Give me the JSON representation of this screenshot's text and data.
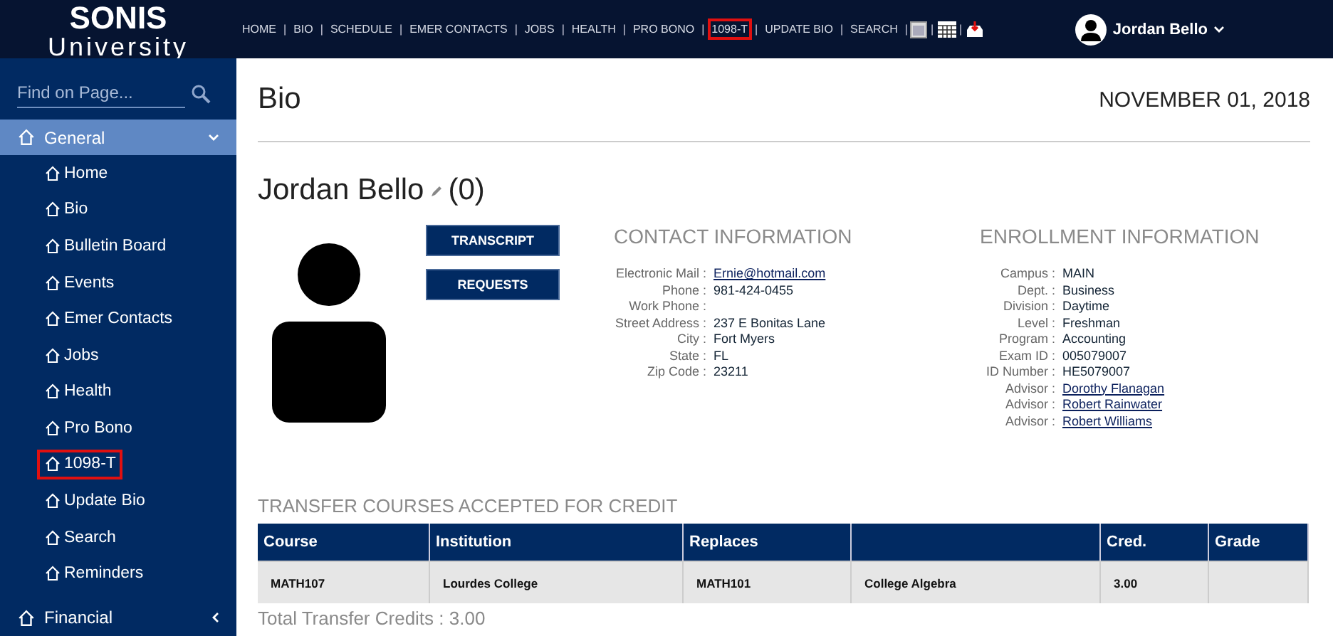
{
  "logo": {
    "line1": "SONIS",
    "line2": "University"
  },
  "top_nav": [
    {
      "label": "HOME",
      "highlighted": false
    },
    {
      "label": "BIO",
      "highlighted": false
    },
    {
      "label": "SCHEDULE",
      "highlighted": false
    },
    {
      "label": "EMER CONTACTS",
      "highlighted": false
    },
    {
      "label": "JOBS",
      "highlighted": false
    },
    {
      "label": "HEALTH",
      "highlighted": false
    },
    {
      "label": "PRO BONO",
      "highlighted": false
    },
    {
      "label": "1098-T",
      "highlighted": true
    },
    {
      "label": "UPDATE BIO",
      "highlighted": false
    },
    {
      "label": "SEARCH",
      "highlighted": false
    }
  ],
  "nav_separator": "|",
  "user": {
    "name": "Jordan Bello"
  },
  "sidebar": {
    "search": {
      "placeholder": "Find on Page..."
    },
    "groups": [
      {
        "label": "General",
        "expanded": true,
        "children": [
          {
            "label": "Home",
            "highlighted": false
          },
          {
            "label": "Bio",
            "highlighted": false
          },
          {
            "label": "Bulletin Board",
            "highlighted": false
          },
          {
            "label": "Events",
            "highlighted": false
          },
          {
            "label": "Emer Contacts",
            "highlighted": false
          },
          {
            "label": "Jobs",
            "highlighted": false
          },
          {
            "label": "Health",
            "highlighted": false
          },
          {
            "label": "Pro Bono",
            "highlighted": false
          },
          {
            "label": "1098-T",
            "highlighted": true
          },
          {
            "label": "Update Bio",
            "highlighted": false
          },
          {
            "label": "Search",
            "highlighted": false
          },
          {
            "label": "Reminders",
            "highlighted": false
          }
        ]
      },
      {
        "label": "Financial",
        "expanded": false
      }
    ]
  },
  "page": {
    "title": "Bio",
    "date": "NOVEMBER 01, 2018",
    "student_name": "Jordan Bello",
    "count": "(0)"
  },
  "buttons": [
    "TRANSCRIPT",
    "REQUESTS"
  ],
  "contact": {
    "title": "CONTACT INFORMATION",
    "fields": [
      {
        "label": "Electronic Mail :",
        "value": "Ernie@hotmail.com",
        "kind": "link"
      },
      {
        "label": "Phone :",
        "value": "981-424-0455",
        "kind": "text"
      },
      {
        "label": "Work Phone :"
      },
      {
        "label": "Street Address :",
        "value": "237 E Bonitas Lane",
        "kind": "text"
      },
      {
        "label": "City :",
        "value": "Fort Myers",
        "kind": "text"
      },
      {
        "label": "State :",
        "value": "FL",
        "kind": "text"
      },
      {
        "label": "Zip Code :",
        "value": "23211",
        "kind": "text"
      }
    ]
  },
  "enrollment": {
    "title": "ENROLLMENT INFORMATION",
    "fields": [
      {
        "label": "Campus :",
        "value": "MAIN",
        "kind": "text"
      },
      {
        "label": "Dept. :",
        "value": "Business",
        "kind": "text"
      },
      {
        "label": "Division :",
        "value": "Daytime",
        "kind": "text"
      },
      {
        "label": "Level :",
        "value": "Freshman",
        "kind": "text"
      },
      {
        "label": "Program :",
        "value": "Accounting",
        "kind": "text"
      },
      {
        "label": "Exam ID :",
        "value": "005079007",
        "kind": "text"
      },
      {
        "label": "ID Number :",
        "value": "HE5079007",
        "kind": "text"
      },
      {
        "label": "Advisor :",
        "value": "Dorothy Flanagan",
        "kind": "link"
      },
      {
        "label": "Advisor :",
        "value": "Robert Rainwater",
        "kind": "link"
      },
      {
        "label": "Advisor :",
        "value": "Robert Williams",
        "kind": "link"
      }
    ]
  },
  "transfer": {
    "title": "TRANSFER COURSES ACCEPTED FOR CREDIT",
    "columns": [
      "Course",
      "Institution",
      "Replaces",
      "",
      "Cred.",
      "Grade"
    ],
    "rows": [
      [
        "MATH107",
        "Lourdes College",
        "MATH101",
        "College Algebra",
        "3.00",
        ""
      ]
    ],
    "total": "Total Transfer Credits : 3.00"
  }
}
